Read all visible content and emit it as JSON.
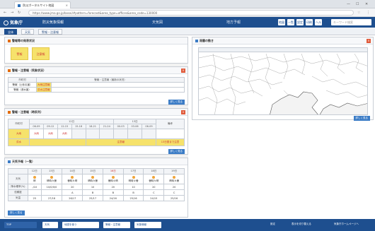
{
  "browser": {
    "tab_title": "防災ポータルサイト地図",
    "url": "https://www.jma.go.jp/bosai/#pattern=forecast&area_type=offices&area_code=130000",
    "minimize": "—",
    "maximize": "☐",
    "close": "✕"
  },
  "header": {
    "logo": "気象庁",
    "site_name": "防災気象情報",
    "menu": [
      "天気図",
      "地方予報"
    ],
    "buttons": [
      "地図",
      "一覧",
      "設定",
      "印刷",
      "ヘルプ"
    ],
    "search_placeholder": "キーワード検索"
  },
  "subtabs": [
    {
      "label": "全体",
      "active": true
    },
    {
      "label": "天気",
      "active": false
    },
    {
      "label": "警報・注意報",
      "active": false
    }
  ],
  "panels": {
    "warnings": {
      "title": "警報等の発表状況",
      "boxes": [
        "警報",
        "注意報"
      ]
    },
    "warn_detail": {
      "title": "警報・注意報（気象状況）",
      "header": [
        "市町村",
        "警報・注意報（最新の状況）"
      ],
      "rows": [
        {
          "name": "警報（土砂災害）",
          "value": "大雨注意報"
        },
        {
          "name": "警報（浸水害）",
          "value": "洪水注意報"
        }
      ],
      "more": "詳しく見る"
    },
    "timeline": {
      "title": "警報・注意報（時系列）",
      "col_head": "市町村",
      "date1": "12日",
      "date2": "13日",
      "note_head": "備考",
      "times": [
        "06-09",
        "09-12",
        "12-15",
        "15-18",
        "18-21",
        "21-24",
        "00-03",
        "03-06",
        "06-09"
      ],
      "rows": [
        {
          "label": "大雨",
          "cells": [
            "大雨",
            "大雨",
            "大雨",
            "",
            "",
            "",
            "",
            "",
            ""
          ],
          "note": ""
        },
        {
          "label": "洪水",
          "cells": [
            "",
            "注意報",
            "",
            "",
            "",
            "",
            "",
            "",
            ""
          ],
          "note": "13日昼まで注意"
        }
      ],
      "more": "詳しく見る"
    },
    "forecast": {
      "title": "天気予報（一覧）",
      "days": [
        "12日",
        "13日",
        "14日",
        "15日",
        "16日",
        "17日",
        "18日",
        "19日"
      ],
      "rows": [
        {
          "label": "天気",
          "values": [
            "晴",
            "晴時々曇",
            "曇時々晴",
            "晴時々曇",
            "曇時々晴",
            "晴時々曇",
            "曇時々晴",
            "晴時々曇"
          ]
        },
        {
          "label": "降水確率(%)",
          "values": [
            "-/10",
            "10/0/0/0",
            "20",
            "10",
            "20",
            "10",
            "20",
            "20"
          ]
        },
        {
          "label": "信頼度",
          "values": [
            "",
            "",
            "A",
            "B",
            "B",
            "B",
            "C",
            "C"
          ]
        },
        {
          "label": "気温",
          "values": [
            "25",
            "27/18",
            "26/17",
            "25/17",
            "24/16",
            "25/16",
            "24/15",
            "25/16"
          ]
        }
      ],
      "more": "詳しく見る"
    },
    "map": {
      "title": "雨雲の動き",
      "more": "詳しく見る"
    }
  },
  "bottom": {
    "buttons": [
      "TOP",
      "天気",
      "地図を使う",
      "警報・注意報",
      "気象情報"
    ],
    "right_texts": [
      "設定",
      "表示を切り替える",
      "気象庁ホームページへ"
    ]
  },
  "colors": {
    "header": "#1e4f8f",
    "highlight": "#f6e26b",
    "accent": "#e05a3a"
  }
}
